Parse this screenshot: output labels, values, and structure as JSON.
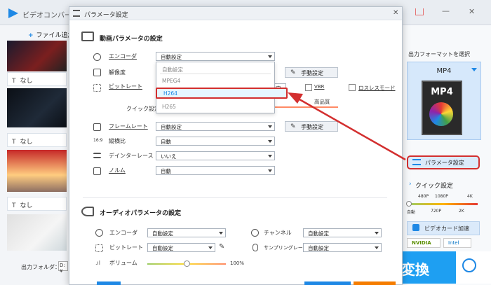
{
  "app": {
    "title": "ビデオコンバー",
    "add_file": "ファイル追加",
    "plus": "+",
    "output_folder_label": "出力フォルダ：",
    "output_path": "D:¥",
    "items": [
      {
        "subtitle": "なし",
        "icon": "T"
      },
      {
        "subtitle": "なし",
        "icon": "T"
      },
      {
        "subtitle": "なし",
        "icon": "T"
      }
    ]
  },
  "right_pane": {
    "format_label": "出力フォーマットを選択",
    "format_name": "MP4",
    "format_icon_text": "MP4",
    "param_button": "パラメータ設定",
    "quick_label": "クイック設定",
    "quick_top_ticks": [
      "480P",
      "1080P",
      "4K"
    ],
    "quick_bottom_ticks": [
      "自動",
      "720P",
      "2K"
    ],
    "gpu_button": "ビデオカード加速",
    "nvidia": "NVIDIA",
    "intel": "Intel",
    "convert_button": "変換",
    "window_minimize": "—",
    "window_close": "✕"
  },
  "dialog": {
    "title": "パラメータ設定",
    "close": "✕",
    "video_section": {
      "title": "動画パラメータの設定",
      "encoder_label": "エンコーダ",
      "encoder_value": "自動設定",
      "resolution_label": "解像度",
      "resolution_button": "手動設定",
      "bitrate_label": "ビットレート",
      "bitrate_value": "定",
      "vbr_label": "VBR",
      "lossless_label": "ロスレスモード",
      "quick_setting_label": "クイック設定",
      "high_quality_label": "高品質",
      "framerate_label": "フレームレート",
      "framerate_value": "自動設定",
      "framerate_button": "手動設定",
      "aspect_label": "縦横比",
      "aspect_value": "自動",
      "deinterlace_label": "デインターレース",
      "deinterlace_value": "いいえ",
      "norm_label": "ノルム",
      "norm_value": "自動"
    },
    "encoder_dropdown": {
      "options": [
        "自動設定",
        "MPEG4",
        "H264",
        "H265"
      ],
      "highlighted": "H264"
    },
    "audio_section": {
      "title": "オーディオパラメータの設定",
      "encoder_label": "エンコーダ",
      "encoder_value": "自動設定",
      "channel_label": "チャンネル",
      "channel_value": "自動設定",
      "bitrate_label": "ビットレート",
      "bitrate_value": "自動設定",
      "samplerate_label": "サンプリングレート",
      "samplerate_value": "自動設定",
      "volume_label": "ボリューム",
      "volume_value": "100%",
      "volume_level": 0.5
    }
  },
  "colors": {
    "accent": "#1e88e5",
    "highlight": "#d32f2f"
  }
}
